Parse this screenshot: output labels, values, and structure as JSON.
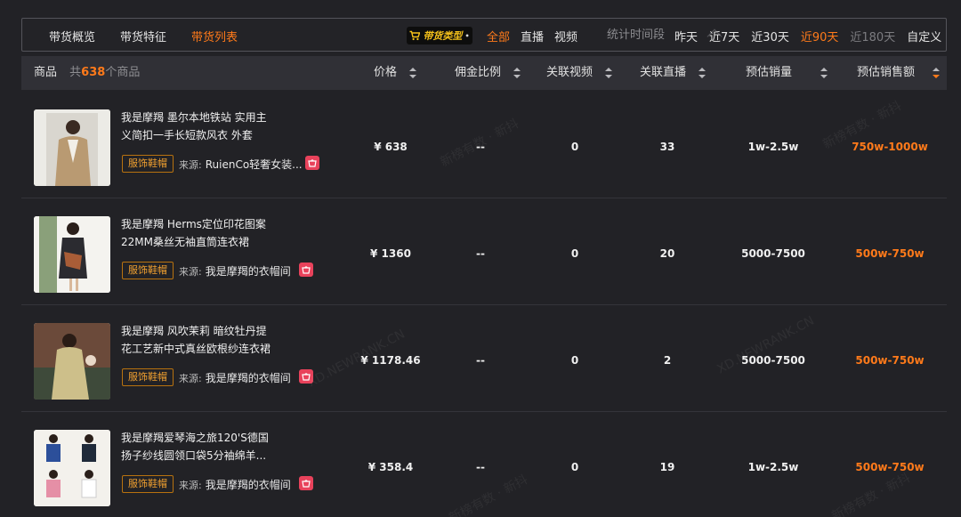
{
  "nav": {
    "tabs": [
      {
        "label": "带货概览",
        "active": false
      },
      {
        "label": "带货特征",
        "active": false
      },
      {
        "label": "带货列表",
        "active": true
      }
    ]
  },
  "filters": {
    "type_badge": "带货类型",
    "type_options": [
      {
        "label": "全部",
        "active": true
      },
      {
        "label": "直播",
        "active": false
      },
      {
        "label": "视频",
        "active": false
      }
    ],
    "time_label": "统计时间段",
    "time_options": [
      {
        "label": "昨天",
        "state": "normal"
      },
      {
        "label": "近7天",
        "state": "normal"
      },
      {
        "label": "近30天",
        "state": "normal"
      },
      {
        "label": "近90天",
        "state": "active"
      },
      {
        "label": "近180天",
        "state": "dim"
      },
      {
        "label": "自定义",
        "state": "normal"
      }
    ]
  },
  "table": {
    "headers": {
      "product": "商品",
      "count_prefix": "共",
      "count": "638",
      "count_suffix": "个商品",
      "price": "价格",
      "commission": "佣金比例",
      "videos": "关联视频",
      "lives": "关联直播",
      "sales": "预估销量",
      "gmv": "预估销售额"
    },
    "source_label": "来源:",
    "rows": [
      {
        "title_line1": "我是摩羯 墨尔本地铁站 实用主",
        "title_line2": "义简扣一手长短款风衣 外套",
        "category": "服饰鞋帽",
        "source": "RuienCo轻奢女装...",
        "price": "¥ 638",
        "commission": "--",
        "videos": "0",
        "lives": "33",
        "sales": "1w-2.5w",
        "gmv": "750w-1000w"
      },
      {
        "title_line1": "我是摩羯 Herms定位印花图案",
        "title_line2": "22MM桑丝无袖直筒连衣裙",
        "category": "服饰鞋帽",
        "source": "我是摩羯的衣帽间",
        "price": "¥ 1360",
        "commission": "--",
        "videos": "0",
        "lives": "20",
        "sales": "5000-7500",
        "gmv": "500w-750w"
      },
      {
        "title_line1": "我是摩羯 风吹茉莉 暗纹牡丹提",
        "title_line2": "花工艺新中式真丝欧根纱连衣裙",
        "category": "服饰鞋帽",
        "source": "我是摩羯的衣帽间",
        "price": "¥ 1178.46",
        "commission": "--",
        "videos": "0",
        "lives": "2",
        "sales": "5000-7500",
        "gmv": "500w-750w"
      },
      {
        "title_line1": "我是摩羯爱琴海之旅120'S德国",
        "title_line2": "扬子纱线圆领口袋5分袖绵羊...",
        "category": "服饰鞋帽",
        "source": "我是摩羯的衣帽间",
        "price": "¥ 358.4",
        "commission": "--",
        "videos": "0",
        "lives": "19",
        "sales": "1w-2.5w",
        "gmv": "500w-750w"
      }
    ]
  },
  "watermarks": [
    "新榜有数 · 新抖",
    "XD.NEWRANK.CN"
  ],
  "colors": {
    "accent": "#ff7a1a",
    "badge_text": "#f6c21a",
    "shop_icon": "#e8425b"
  }
}
